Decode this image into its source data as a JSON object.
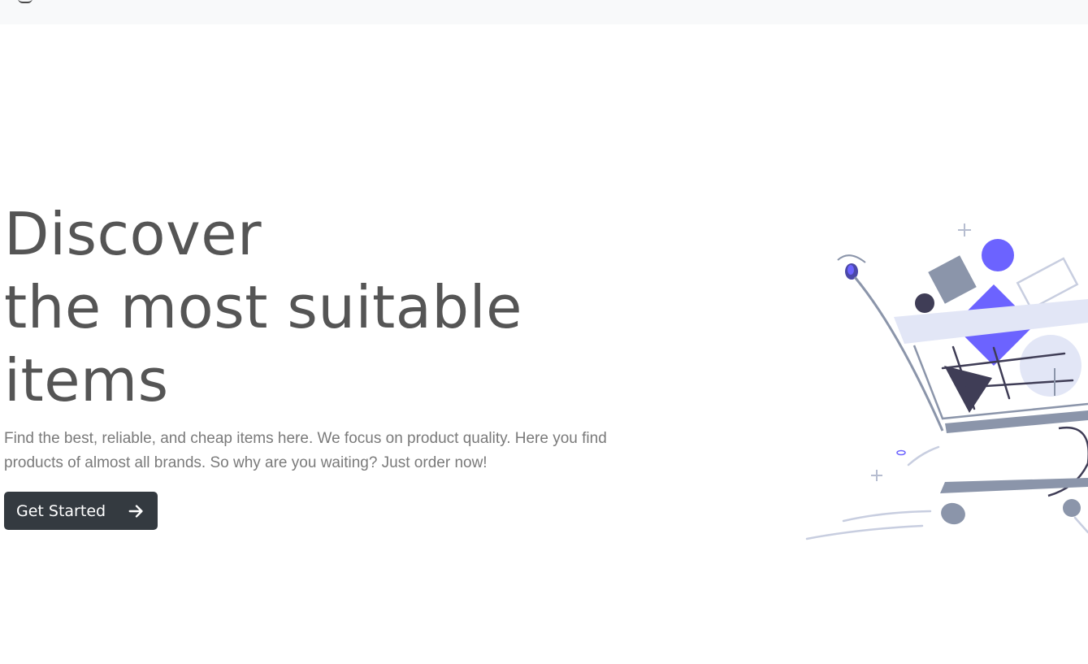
{
  "hero": {
    "headline_line1": "Discover",
    "headline_line2": "the most suitable",
    "headline_line3": "items",
    "description": "Find the best, reliable, and cheap items here. We focus on product quality. Here you find products of almost all brands. So why are you waiting? Just order now!",
    "cta_label": "Get Started",
    "cta_icon": "arrow-right-icon"
  },
  "illustration": {
    "icon": "shopping-cart-illustration",
    "colors": {
      "accent": "#6c63ff",
      "dark": "#3f3d56",
      "muted": "#8b95aa",
      "light": "#e2e6f6"
    }
  },
  "colors": {
    "topbar": "#f8f9fa",
    "headline": "#555555",
    "text": "#7a7a7a",
    "button": "#343a40"
  }
}
